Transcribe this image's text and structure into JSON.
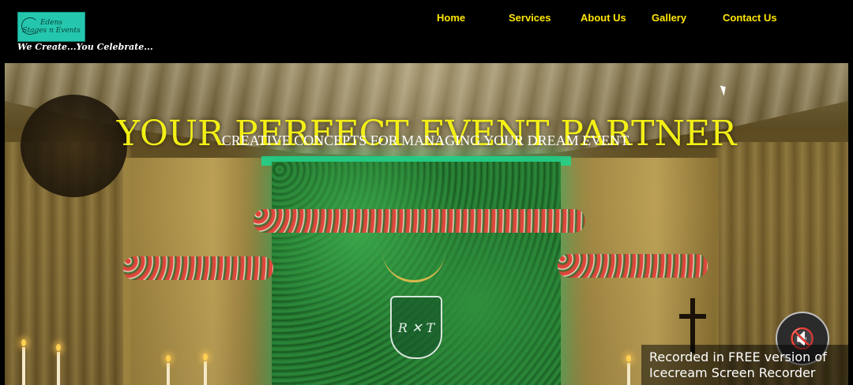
{
  "brand": {
    "logo_line1": "Edens",
    "logo_line2": "Stages n Events",
    "tagline": "We Create...You Celebrate..."
  },
  "nav": {
    "items": [
      {
        "label": "Home"
      },
      {
        "label": "Services"
      },
      {
        "label": "About Us"
      },
      {
        "label": "Gallery"
      },
      {
        "label": "Contact Us"
      }
    ]
  },
  "hero": {
    "headline": "YOUR PERFECT EVENT PARTNER",
    "subheadline": "CREATIVE CONCEPTS FOR MANAGING YOUR DREAM EVENT.",
    "crest_mark": "R ✕ T"
  },
  "overlay": {
    "watermark_line1": "Recorded in FREE version of",
    "watermark_line2": "Icecream  Screen  Recorder",
    "mute_icon": "speaker-muted-icon"
  },
  "colors": {
    "nav_text": "#ffe600",
    "headline": "#f3ef16",
    "logo_bg": "#24c7ad"
  }
}
